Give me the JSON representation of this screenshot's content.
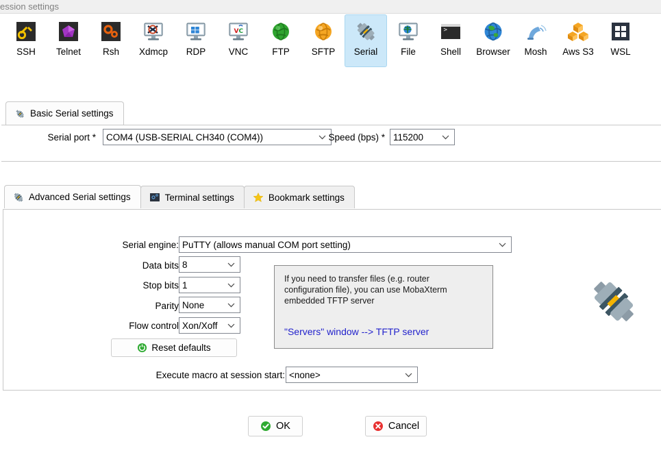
{
  "window": {
    "title": "ession settings"
  },
  "session_types": {
    "selected": "Serial",
    "items": [
      {
        "label": "SSH",
        "icon": "ssh-key-icon"
      },
      {
        "label": "Telnet",
        "icon": "telnet-gem-icon"
      },
      {
        "label": "Rsh",
        "icon": "rsh-gears-icon"
      },
      {
        "label": "Xdmcp",
        "icon": "xdmcp-monitor-icon"
      },
      {
        "label": "RDP",
        "icon": "rdp-windows-monitor-icon"
      },
      {
        "label": "VNC",
        "icon": "vnc-monitor-icon"
      },
      {
        "label": "FTP",
        "icon": "ftp-green-globe-icon"
      },
      {
        "label": "SFTP",
        "icon": "sftp-orange-globe-icon"
      },
      {
        "label": "Serial",
        "icon": "serial-plug-icon"
      },
      {
        "label": "File",
        "icon": "file-globe-monitor-icon"
      },
      {
        "label": "Shell",
        "icon": "shell-terminal-icon"
      },
      {
        "label": "Browser",
        "icon": "browser-globe-icon"
      },
      {
        "label": "Mosh",
        "icon": "mosh-satellite-icon"
      },
      {
        "label": "Aws S3",
        "icon": "aws-s3-cubes-icon"
      },
      {
        "label": "WSL",
        "icon": "wsl-windows-icon"
      }
    ]
  },
  "basic_tab": {
    "label": "Basic Serial settings",
    "icon": "serial-plug-icon",
    "serial_port": {
      "label": "Serial port *",
      "value": "COM4  (USB-SERIAL CH340 (COM4))"
    },
    "speed": {
      "label": "Speed (bps) *",
      "value": "115200"
    }
  },
  "lower_tabs": [
    {
      "label": "Advanced Serial settings",
      "icon": "serial-plug-icon",
      "active": true
    },
    {
      "label": "Terminal settings",
      "icon": "terminal-settings-icon",
      "active": false
    },
    {
      "label": "Bookmark settings",
      "icon": "star-icon",
      "active": false
    }
  ],
  "advanced": {
    "serial_engine": {
      "label": "Serial engine:",
      "value": "PuTTY   (allows manual COM port setting)"
    },
    "data_bits": {
      "label": "Data bits",
      "value": "8"
    },
    "stop_bits": {
      "label": "Stop bits",
      "value": "1"
    },
    "parity": {
      "label": "Parity",
      "value": "None"
    },
    "flow_control": {
      "label": "Flow control",
      "value": "Xon/Xoff"
    },
    "reset_defaults": {
      "label": "Reset defaults",
      "icon": "reset-power-icon"
    },
    "execute_macro": {
      "label": "Execute macro at session start:",
      "value": "<none>"
    },
    "tftp_hint": {
      "text": "If you need to transfer files (e.g. router\nconfiguration file), you can use MobaXterm\nembedded TFTP server",
      "link": "\"Servers\" window  -->  TFTP server",
      "link_color": "#2222cc",
      "background": "#eeeeee"
    },
    "decoration_icon": "serial-plug-large-icon"
  },
  "buttons": {
    "ok": {
      "label": "OK",
      "icon": "check-circle-green-icon"
    },
    "cancel": {
      "label": "Cancel",
      "icon": "x-circle-red-icon"
    }
  },
  "colors": {
    "selection_blue": "#cce8f9",
    "panel_border": "#c8c8c8",
    "title_grey": "#808080",
    "link_blue": "#2222cc"
  }
}
